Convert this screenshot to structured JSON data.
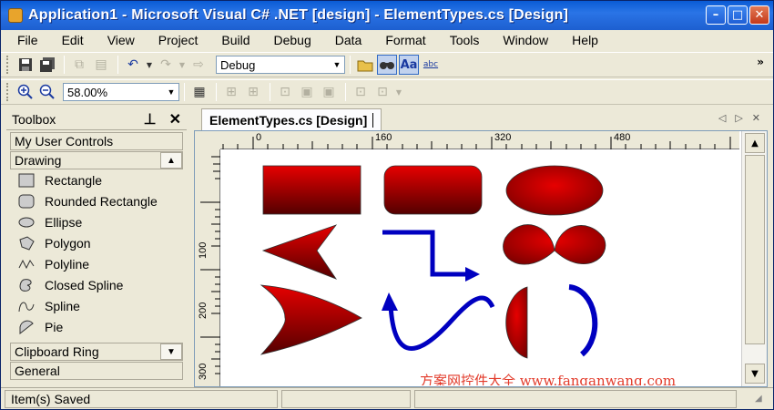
{
  "window": {
    "title": "Application1 - Microsoft Visual C# .NET [design] - ElementTypes.cs [Design]",
    "buttons": [
      "minimize",
      "maximize",
      "close"
    ]
  },
  "menu": [
    "File",
    "Edit",
    "View",
    "Project",
    "Build",
    "Debug",
    "Data",
    "Format",
    "Tools",
    "Window",
    "Help"
  ],
  "toolbar1": {
    "config": "Debug"
  },
  "toolbar2": {
    "zoom": "58.00%"
  },
  "toolbox": {
    "title": "Toolbox",
    "tabs": {
      "my_user_controls": "My User Controls",
      "drawing": "Drawing",
      "clipboard_ring": "Clipboard Ring",
      "general": "General"
    },
    "items": [
      {
        "label": "Rectangle",
        "icon": "rectangle-icon"
      },
      {
        "label": "Rounded Rectangle",
        "icon": "rounded-rectangle-icon"
      },
      {
        "label": "Ellipse",
        "icon": "ellipse-icon"
      },
      {
        "label": "Polygon",
        "icon": "polygon-icon"
      },
      {
        "label": "Polyline",
        "icon": "polyline-icon"
      },
      {
        "label": "Closed Spline",
        "icon": "closed-spline-icon"
      },
      {
        "label": "Spline",
        "icon": "spline-icon"
      },
      {
        "label": "Pie",
        "icon": "pie-icon"
      }
    ]
  },
  "designer": {
    "tab_title": "ElementTypes.cs [Design]",
    "ruler_h": [
      "0",
      "160",
      "320",
      "480"
    ],
    "ruler_v": [
      "100",
      "200",
      "300"
    ]
  },
  "watermark": "方案网控件大全 www.fanganwang.com",
  "status": {
    "message": "Item(s) Saved"
  },
  "colors": {
    "shape_fill_top": "#e00000",
    "shape_fill_bottom": "#5a0000",
    "line_blue": "#0000c0"
  }
}
